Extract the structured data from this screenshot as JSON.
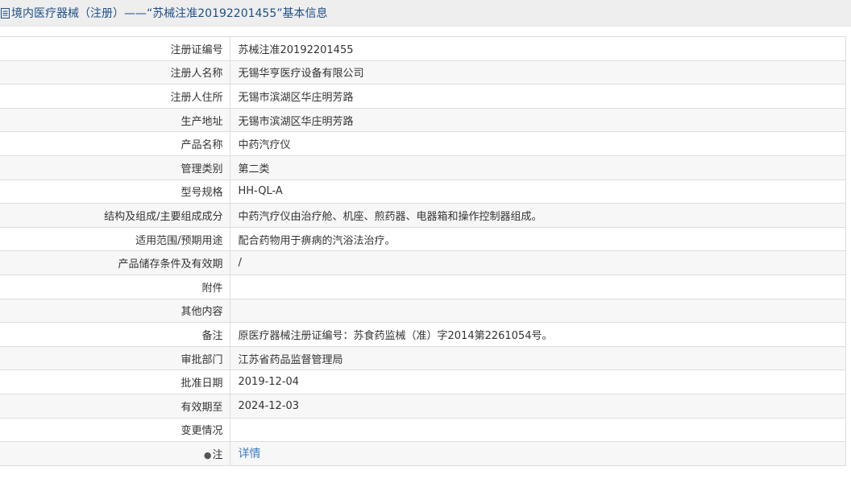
{
  "header": {
    "title": "境内医疗器械（注册）——“苏械注准20192201455”基本信息",
    "icon": "document-icon"
  },
  "rows": [
    {
      "label": "注册证编号",
      "value": "苏械注准20192201455"
    },
    {
      "label": "注册人名称",
      "value": "无锡华亨医疗设备有限公司"
    },
    {
      "label": "注册人住所",
      "value": "无锡市滨湖区华庄明芳路"
    },
    {
      "label": "生产地址",
      "value": "无锡市滨湖区华庄明芳路"
    },
    {
      "label": "产品名称",
      "value": "中药汽疗仪"
    },
    {
      "label": "管理类别",
      "value": "第二类"
    },
    {
      "label": "型号规格",
      "value": "HH-QL-A"
    },
    {
      "label": "结构及组成/主要组成成分",
      "value": "中药汽疗仪由治疗舱、机座、煎药器、电器箱和操作控制器组成。"
    },
    {
      "label": "适用范围/预期用途",
      "value": "配合药物用于痹病的汽浴法治疗。"
    },
    {
      "label": "产品储存条件及有效期",
      "value": "/"
    },
    {
      "label": "附件",
      "value": ""
    },
    {
      "label": "其他内容",
      "value": ""
    },
    {
      "label": "备注",
      "value": "原医疗器械注册证编号：苏食药监械（准）字2014第2261054号。"
    },
    {
      "label": "审批部门",
      "value": "江苏省药品监督管理局"
    },
    {
      "label": "批准日期",
      "value": "2019-12-04"
    },
    {
      "label": "有效期至",
      "value": "2024-12-03"
    },
    {
      "label": "变更情况",
      "value": ""
    }
  ],
  "note": {
    "label": "注",
    "icon": "info-pin-icon",
    "link_text": "详情",
    "link_color": "#3a7ec3"
  }
}
